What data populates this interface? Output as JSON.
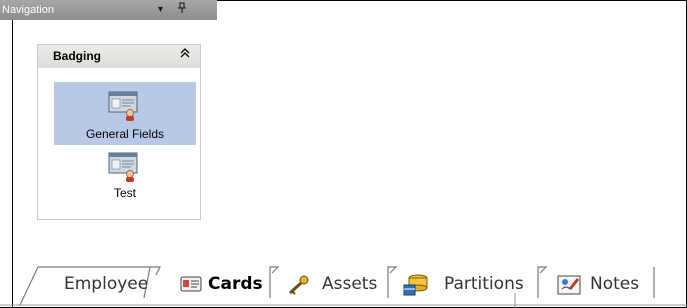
{
  "navigation": {
    "title": "Navigation",
    "dropdown_glyph": "▾",
    "pin_glyph": "⊣"
  },
  "badging_panel": {
    "title": "Badging",
    "collapse_glyph": "⌃⌃",
    "items": [
      {
        "label": "General Fields",
        "icon": "badge-layout-icon",
        "selected": true
      },
      {
        "label": "Test",
        "icon": "badge-layout-icon",
        "selected": false
      }
    ]
  },
  "tabs": [
    {
      "label": "Employee",
      "icon": "",
      "active": false
    },
    {
      "label": "Cards",
      "icon": "card-icon",
      "active": true
    },
    {
      "label": "Assets",
      "icon": "key-icon",
      "active": false
    },
    {
      "label": "Partitions",
      "icon": "partitions-icon",
      "active": false
    },
    {
      "label": "Notes",
      "icon": "notes-icon",
      "active": false
    }
  ],
  "colors": {
    "selection": "#b7c9e7",
    "header": "#9a9a9a"
  }
}
